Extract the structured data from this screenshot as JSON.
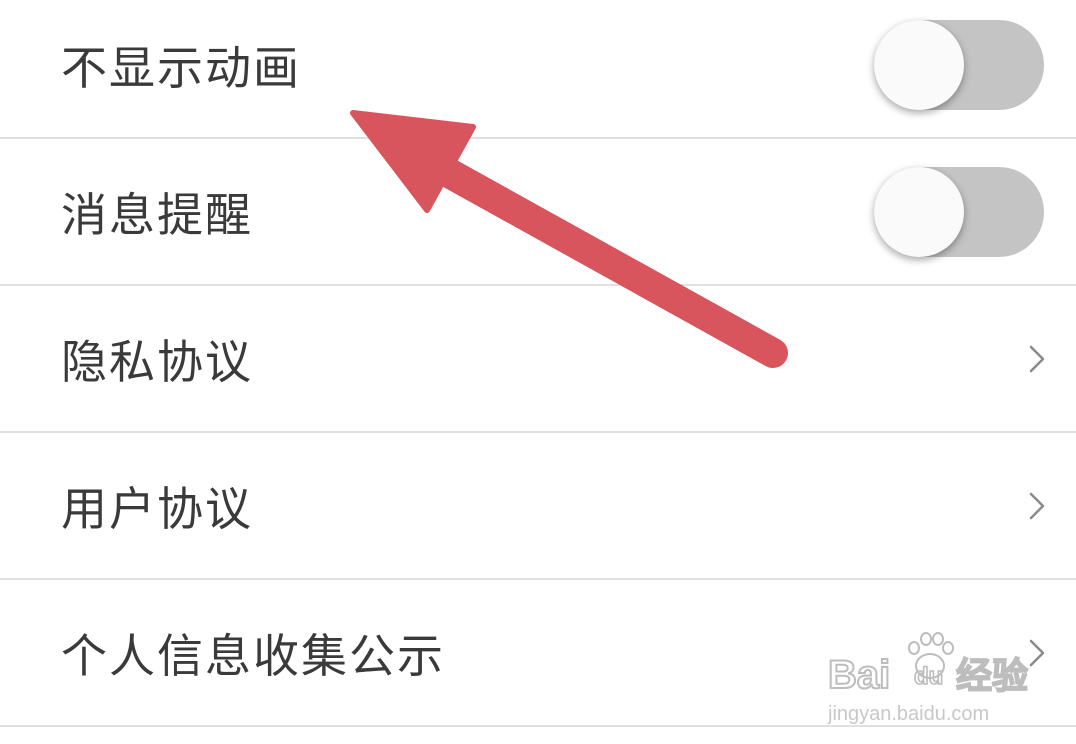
{
  "settings": {
    "items": [
      {
        "label": "不显示动画",
        "control": "toggle",
        "enabled": false
      },
      {
        "label": "消息提醒",
        "control": "toggle",
        "enabled": false
      },
      {
        "label": "隐私协议",
        "control": "chevron"
      },
      {
        "label": "用户协议",
        "control": "chevron"
      },
      {
        "label": "个人信息收集公示",
        "control": "chevron"
      }
    ]
  },
  "annotation": {
    "color": "#d9555e",
    "icon": "pointer-arrow-icon"
  },
  "watermark": {
    "logo_text": "Bai du 经验",
    "url_text": "jingyan.baidu.com"
  },
  "colors": {
    "toggle_track_off": "#c4c4c4",
    "toggle_knob": "#fafafa",
    "divider": "#e0e0e0",
    "label_text": "#3a3a3a",
    "chevron": "#8a8a8a"
  }
}
